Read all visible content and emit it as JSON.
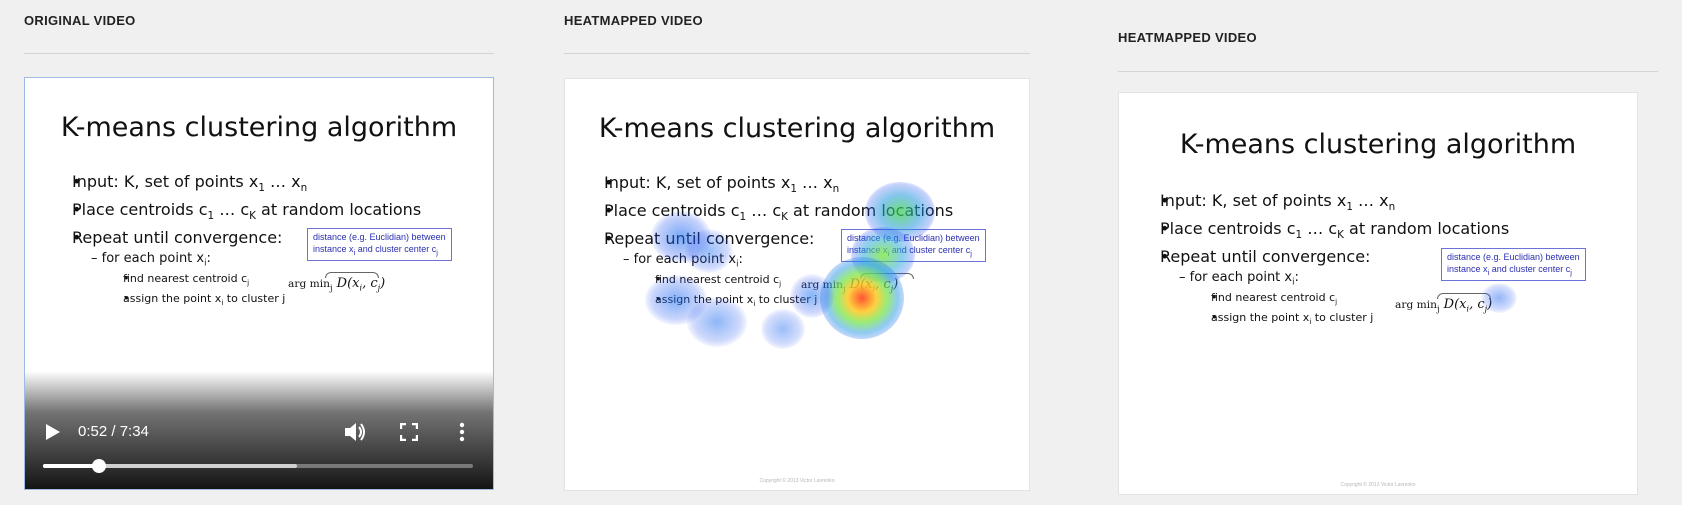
{
  "columns": [
    {
      "title": "ORIGINAL VIDEO"
    },
    {
      "title": "HEATMAPPED VIDEO"
    },
    {
      "title": "HEATMAPPED VIDEO"
    }
  ],
  "slide": {
    "title": "K-means clustering algorithm",
    "bullet1_pre": "Input: K, set of points x",
    "bullet1_sub1": "1",
    "bullet1_mid": " … x",
    "bullet1_sub2": "n",
    "bullet2_pre": "Place centroids c",
    "bullet2_sub1": "1",
    "bullet2_mid": " … c",
    "bullet2_sub2": "K",
    "bullet2_post": " at random locations",
    "bullet3": "Repeat until convergence:",
    "sub1_pre": "– for each point x",
    "sub1_sub": "i",
    "sub1_post": ":",
    "subsub1_pre": "find nearest centroid c",
    "subsub1_sub": "j",
    "subsub2_pre": "assign the point x",
    "subsub2_sub": "i",
    "subsub2_post": " to cluster j",
    "box_line1": "distance (e.g. Euclidian) between",
    "box_line2_pre": "instance x",
    "box_line2_sub1": "i",
    "box_line2_mid": " and cluster center c",
    "box_line2_sub2": "j",
    "formula_argmin": "arg min",
    "formula_sub": "j",
    "formula_expr": "D(x",
    "formula_sub_i": "i",
    "formula_comma": ", c",
    "formula_sub_j": "j",
    "formula_close": ")",
    "copyright": "Copyright © 2013 Victor Lavrenko"
  },
  "player": {
    "time": "0:52 / 7:34",
    "progress_fraction": 0.13,
    "buffered_fraction": 0.59,
    "icons": {
      "play": "play-icon",
      "volume": "volume-icon",
      "fullscreen": "fullscreen-icon",
      "more": "more-vert-icon"
    }
  },
  "colors": {
    "accent_border": "#9fbbe3",
    "box_text": "#2b2fb0",
    "box_border": "#6b73d6"
  }
}
